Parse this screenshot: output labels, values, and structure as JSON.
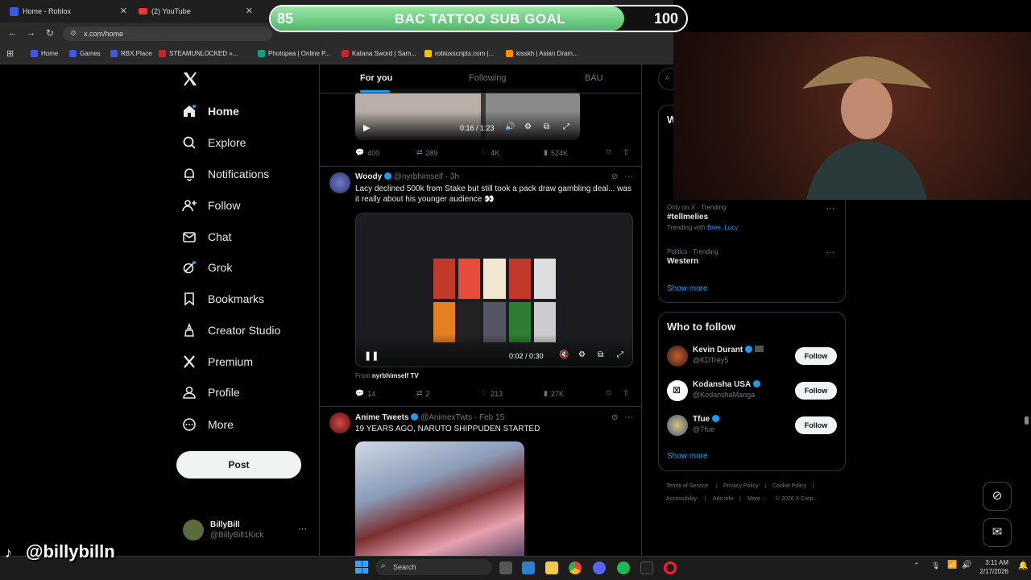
{
  "browser": {
    "tabs": [
      {
        "title": "Home - Roblox"
      },
      {
        "title": "(2) YouTube"
      }
    ],
    "url": "x.com/home",
    "bookmarks": [
      {
        "label": "Home",
        "color": "#3b5bdb"
      },
      {
        "label": "Games",
        "color": "#3b5bdb"
      },
      {
        "label": "RBX.Place",
        "color": "#3b5bdb"
      },
      {
        "label": "STEAMUNLOCKED »...",
        "color": "#c62828"
      },
      {
        "label": "Photopea | Online P...",
        "color": "#14a085"
      },
      {
        "label": "Katana Sword | Sam...",
        "color": "#c62828"
      },
      {
        "label": "robloxscripts.com |...",
        "color": "#f5c400"
      },
      {
        "label": "kisskh | Asian Dram...",
        "color": "#ff8f00"
      }
    ]
  },
  "goal": {
    "current": "85",
    "title": "BAC TATTOO SUB GOAL",
    "max": "100",
    "progress": 0.85
  },
  "nav": {
    "items": [
      {
        "label": "Home",
        "icon": "home-icon"
      },
      {
        "label": "Explore",
        "icon": "search-icon"
      },
      {
        "label": "Notifications",
        "icon": "bell-icon"
      },
      {
        "label": "Follow",
        "icon": "person-add-icon"
      },
      {
        "label": "Chat",
        "icon": "envelope-icon"
      },
      {
        "label": "Grok",
        "icon": "grok-icon"
      },
      {
        "label": "Bookmarks",
        "icon": "bookmark-icon"
      },
      {
        "label": "Creator Studio",
        "icon": "creator-icon"
      },
      {
        "label": "Premium",
        "icon": "x-icon"
      },
      {
        "label": "Profile",
        "icon": "person-icon"
      },
      {
        "label": "More",
        "icon": "more-circle-icon"
      }
    ],
    "post_label": "Post",
    "account": {
      "name": "BillyBill",
      "handle": "@BillyBill1Kick"
    }
  },
  "feed": {
    "tabs": [
      "For you",
      "Following",
      "BAU"
    ],
    "tweet1": {
      "video_time": "0:16 / 1:23",
      "replies": "400",
      "reposts": "289",
      "likes": "4K",
      "views": "524K"
    },
    "tweet2": {
      "name": "Woody",
      "handle": "@nyrbhimself",
      "time": "· 3h",
      "text": "Lacy declined 500k from Stake but still took a pack draw gambling deal... was it really about his younger audience 👀",
      "video_time": "0:02 / 0:30",
      "from_prefix": "From",
      "from_source": "nyrbhimself TV",
      "replies": "14",
      "reposts": "2",
      "likes": "213",
      "views": "27K"
    },
    "tweet3": {
      "name": "Anime Tweets",
      "handle": "@AnimexTwts",
      "time": "· Feb 15",
      "text": "19 YEARS AGO, NARUTO SHIPPUDEN STARTED"
    }
  },
  "right": {
    "whats_happening": {
      "partial_heading": "W",
      "trends": [
        {
          "meta": "Only on X · Trending",
          "name": "#tellmelies",
          "extra_prefix": "Trending with",
          "extra_links": "Bree, Lucy"
        },
        {
          "meta": "Politics · Trending",
          "name": "Western"
        }
      ],
      "show_more": "Show more"
    },
    "who_to_follow": {
      "title": "Who to follow",
      "users": [
        {
          "name": "Kevin Durant",
          "handle": "@KDTrey5",
          "follow": "Follow"
        },
        {
          "name": "Kodansha USA",
          "handle": "@KodanshaManga",
          "follow": "Follow"
        },
        {
          "name": "Tfue",
          "handle": "@Tfue",
          "follow": "Follow"
        }
      ],
      "show_more": "Show more"
    },
    "footer": [
      "Terms of Service",
      "|",
      "Privacy Policy",
      "|",
      "Cookie Policy",
      "|",
      "Accessibility",
      "|",
      "Ads info",
      "|",
      "More ···",
      "© 2026 X Corp."
    ]
  },
  "taskbar": {
    "search_placeholder": "Search",
    "time": "3:11 AM",
    "date": "2/17/2026"
  },
  "watermark": "@billybilln"
}
